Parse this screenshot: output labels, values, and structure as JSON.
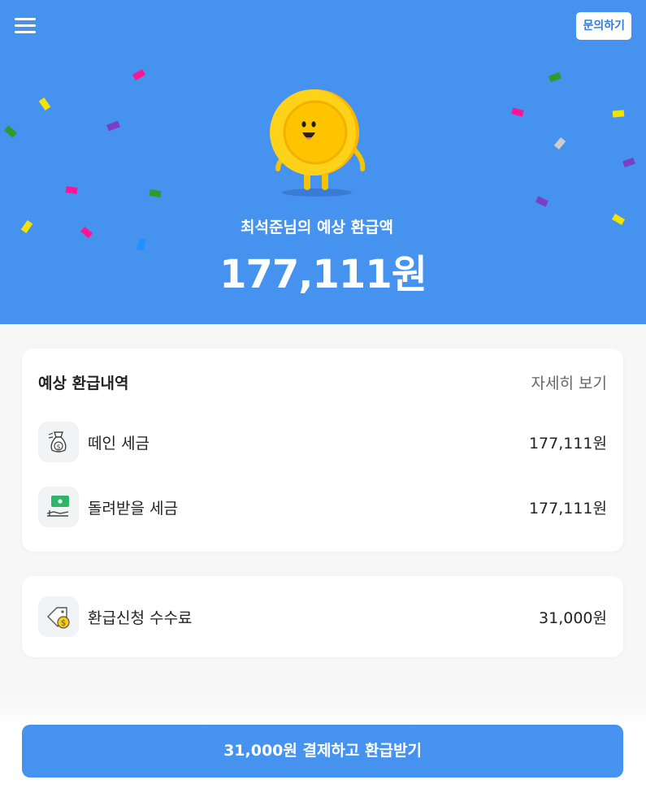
{
  "header": {
    "menu_icon": "hamburger-menu-icon",
    "inquiry_label": "문의하기"
  },
  "hero": {
    "label": "최석준님의 예상 환급액",
    "amount": "177,111원",
    "background": "#4593ee",
    "mascot": "coin-character"
  },
  "breakdown": {
    "title": "예상 환급내역",
    "detail_link": "자세히 보기",
    "rows": [
      {
        "label": "떼인 세금",
        "value": "177,111원",
        "icon": "money-bag-icon"
      },
      {
        "label": "돌려받을 세금",
        "value": "177,111원",
        "icon": "cash-hand-icon"
      }
    ]
  },
  "fee": {
    "label": "환급신청 수수료",
    "value": "31,000원",
    "icon": "price-tag-coin-icon"
  },
  "cta": {
    "label": "31,000원 결제하고 환급받기",
    "color": "#4593ee"
  },
  "colors": {
    "confetti": [
      "#f4e200",
      "#ff1493",
      "#2a9d2a",
      "#7b3fc6",
      "#1e90ff",
      "#cccccc"
    ]
  }
}
